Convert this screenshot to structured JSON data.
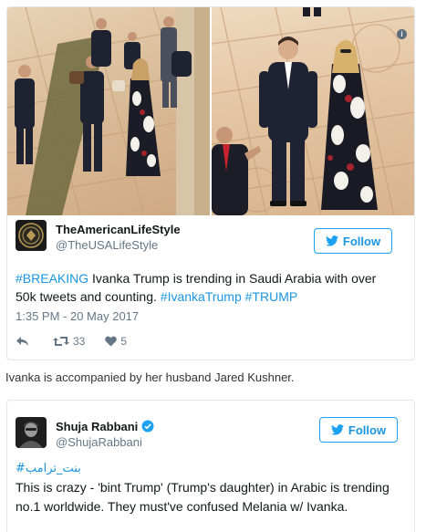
{
  "tweet1": {
    "author_name": "TheAmericanLifeStyle",
    "handle": "@TheUSALifeStyle",
    "follow_label": "Follow",
    "text_hashtag_breaking": "#BREAKING",
    "text_body": " Ivanka Trump is trending in Saudi Arabia with over 50k tweets and counting. ",
    "text_hashtag_ivanka": "#IvankaTrump",
    "text_hashtag_trump": "#TRUMP",
    "timestamp": "1:35 PM - 20 May 2017",
    "retweets": "33",
    "likes": "5",
    "photo_info_symbol": "i"
  },
  "caption": "Ivanka is accompanied by her husband Jared Kushner.",
  "tweet2": {
    "author_name": "Shuja Rabbani",
    "handle": "@ShujaRabbani",
    "follow_label": "Follow",
    "arabic_hashtag": "#بنت_ترامب",
    "text": "This is crazy - 'bint Trump' (Trump's daughter) in Arabic is trending no.1 worldwide. They must've confused Melania w/ Ivanka."
  },
  "colors": {
    "link": "#1b95e0",
    "follow_border": "#1da1f2",
    "secondary_text": "#657786",
    "border": "#e1e8ed",
    "verified": "#1da1f2"
  },
  "icons": [
    "twitter-bird-icon",
    "reply-icon",
    "retweet-icon",
    "heart-icon",
    "verified-badge-icon",
    "info-icon"
  ]
}
